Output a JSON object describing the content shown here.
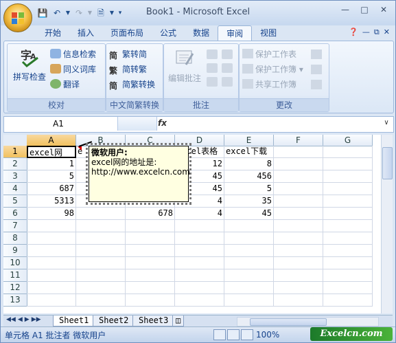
{
  "window": {
    "title": "Book1 - Microsoft Excel"
  },
  "qat": {
    "save_icon": "save-icon",
    "undo_icon": "undo-icon",
    "redo_icon": "redo-icon",
    "preview_icon": "print-preview-icon",
    "more_icon": "customize-icon"
  },
  "tabs": [
    "开始",
    "插入",
    "页面布局",
    "公式",
    "数据",
    "审阅",
    "视图"
  ],
  "active_tab": "审阅",
  "ribbon": {
    "proofing": {
      "label": "校对",
      "spell": "拼写检查",
      "research": "信息检索",
      "thesaurus": "同义词库",
      "translate": "翻译"
    },
    "chinese": {
      "label": "中文简繁转换",
      "t2s": "繁转简",
      "s2t": "简转繁",
      "convert": "简繁转换"
    },
    "comments": {
      "label": "批注",
      "edit": "编辑批注"
    },
    "changes": {
      "label": "更改",
      "protect_sheet": "保护工作表",
      "protect_workbook": "保护工作簿",
      "share_workbook": "共享工作簿"
    }
  },
  "formula_bar": {
    "name_box": "A1",
    "fx": "fx",
    "content": ""
  },
  "grid": {
    "columns": [
      "A",
      "B",
      "C",
      "D",
      "E",
      "F",
      "G"
    ],
    "rows": [
      "1",
      "2",
      "3",
      "4",
      "5",
      "6",
      "7",
      "8",
      "9",
      "10",
      "11",
      "12",
      "13"
    ],
    "cells": {
      "A1": "excel网",
      "B1": "e",
      "D1": "excel表格",
      "E1": "excel下载",
      "A2": "1",
      "D2": "12",
      "E2": "8",
      "A3": "5",
      "D3": "45",
      "E3": "456",
      "A4": "687",
      "D4": "45",
      "E4": "5",
      "A5": "5313",
      "D5": "4",
      "E5": "35",
      "A6": "98",
      "C6": "678",
      "D6": "4",
      "E6": "45"
    }
  },
  "comment": {
    "author": "微软用户:",
    "line1": "excel网的地址是:",
    "line2": "http://www.excelcn.com"
  },
  "sheets": [
    "Sheet1",
    "Sheet2",
    "Sheet3"
  ],
  "active_sheet": "Sheet1",
  "status": {
    "message": "单元格 A1 批注者 微软用户",
    "zoom": "100%"
  },
  "watermark": "Excelcn.com"
}
